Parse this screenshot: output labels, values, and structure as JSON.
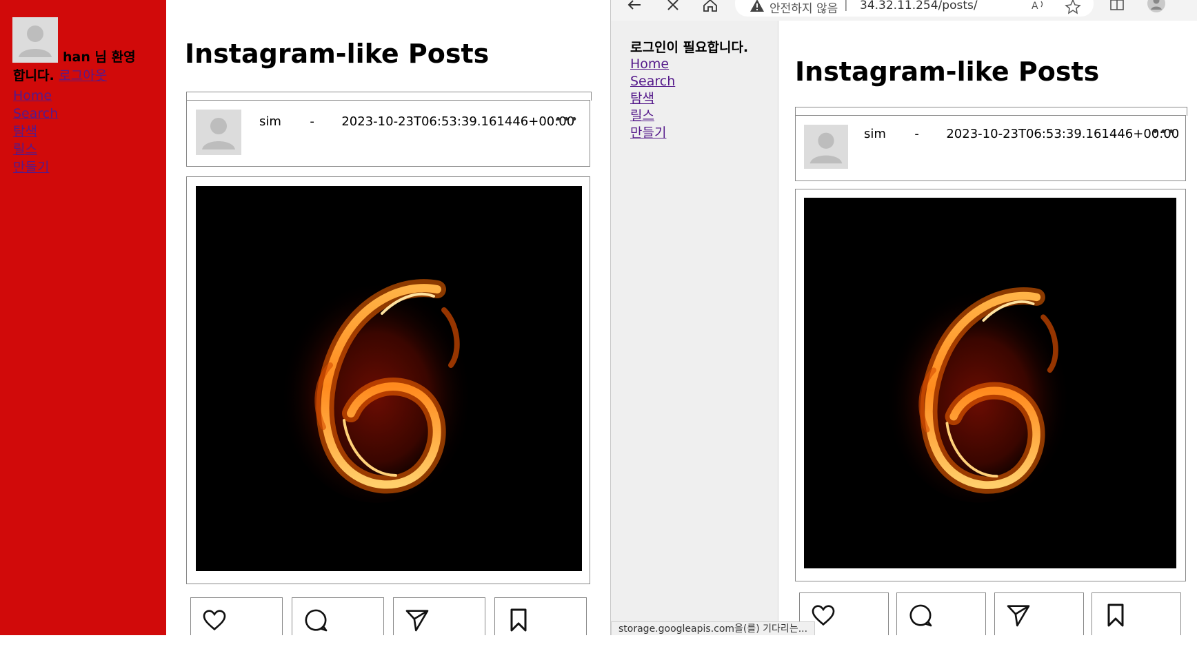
{
  "left": {
    "welcome_name": "han 님 환영",
    "welcome_rest": "합니다.",
    "logout_link": "로그아웃",
    "nav": [
      "Home",
      "Search",
      "탐색",
      "릴스",
      "만들기"
    ],
    "sidebar_color": "#d10a0a"
  },
  "right": {
    "toolbar": {
      "security_label": "안전하지 않음",
      "separator": "|",
      "url": "34.32.11.254/posts/"
    },
    "login_required": "로그인이 필요합니다.",
    "nav": [
      "Home",
      "Search",
      "탐색",
      "릴스",
      "만들기"
    ],
    "status_bar": "storage.googleapis.com을(를) 기다리는..."
  },
  "page": {
    "title": "Instagram-like Posts"
  },
  "post": {
    "username": "sim",
    "separator": "-",
    "timestamp": "2023-10-23T06:53:39.161446+00:00",
    "more_icon": "ellipsis-icon",
    "image": "fire number six"
  },
  "actions": [
    {
      "name": "like",
      "icon": "heart-icon"
    },
    {
      "name": "comment",
      "icon": "comment-icon"
    },
    {
      "name": "share",
      "icon": "send-icon"
    },
    {
      "name": "save",
      "icon": "bookmark-icon"
    }
  ]
}
